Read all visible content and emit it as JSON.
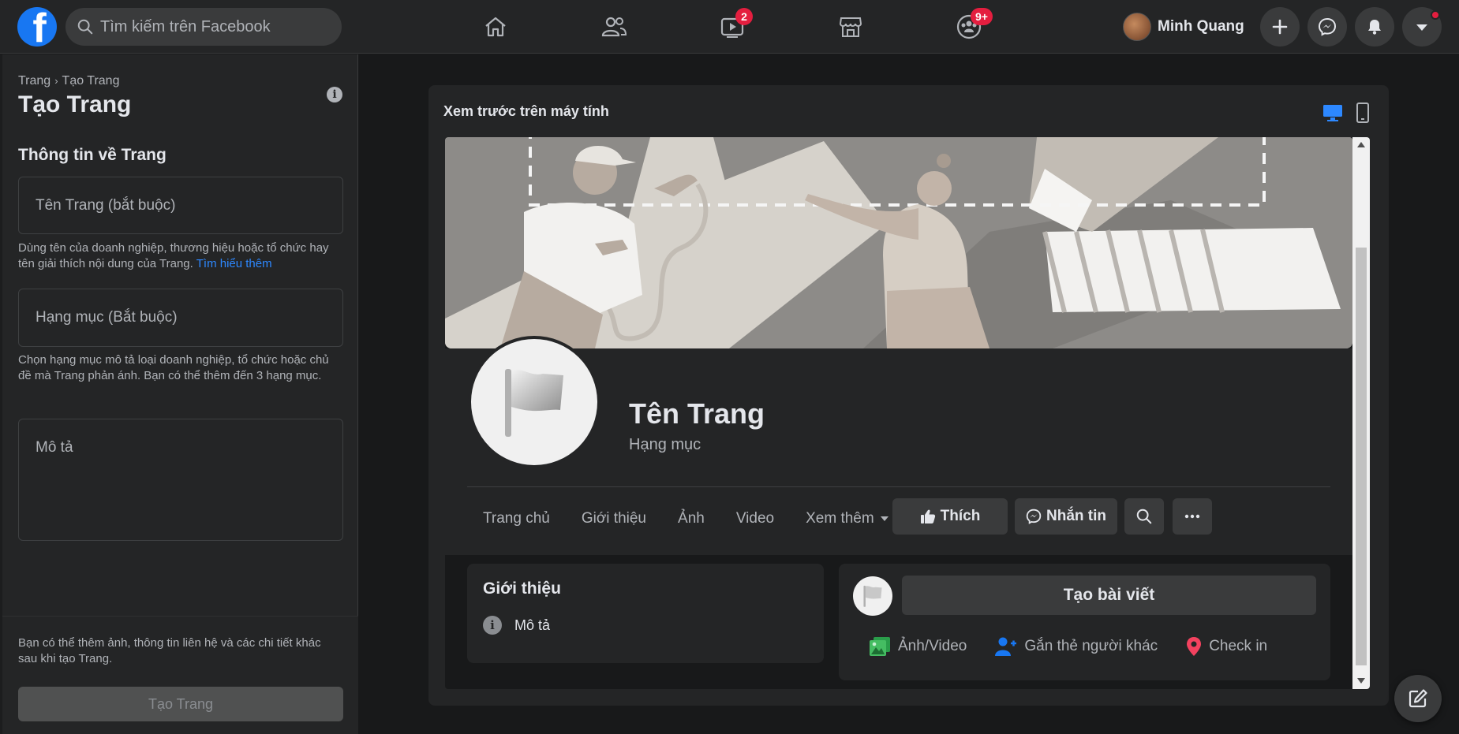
{
  "topbar": {
    "logo_letter": "f",
    "search_placeholder": "Tìm kiếm trên Facebook",
    "nav": [
      {
        "name": "home-icon"
      },
      {
        "name": "friends-icon"
      },
      {
        "name": "watch-icon",
        "badge": "2"
      },
      {
        "name": "marketplace-icon"
      },
      {
        "name": "groups-icon",
        "badge": "9+"
      }
    ],
    "profile_name": "Minh Quang",
    "right_buttons": [
      "plus-icon",
      "messenger-icon",
      "bell-icon",
      "caret-down-icon"
    ]
  },
  "left_panel": {
    "breadcrumb_root": "Trang",
    "breadcrumb_sep": "›",
    "breadcrumb_current": "Tạo Trang",
    "title": "Tạo Trang",
    "section_title": "Thông tin về Trang",
    "name_placeholder": "Tên Trang (bắt buộc)",
    "name_hint": "Dùng tên của doanh nghiệp, thương hiệu hoặc tổ chức hay tên giải thích nội dung của Trang.",
    "learn_more": "Tìm hiểu thêm",
    "category_placeholder": "Hạng mục (Bắt buộc)",
    "category_hint": "Chọn hạng mục mô tả loại doanh nghiệp, tổ chức hoặc chủ đề mà Trang phản ánh. Bạn có thể thêm đến 3 hạng mục.",
    "description_placeholder": "Mô tả",
    "footer_text": "Bạn có thể thêm ảnh, thông tin liên hệ và các chi tiết khác sau khi tạo Trang.",
    "create_button": "Tạo Trang"
  },
  "preview": {
    "title": "Xem trước trên máy tính",
    "page_name": "Tên Trang",
    "category": "Hạng mục",
    "tabs": [
      "Trang chủ",
      "Giới thiệu",
      "Ảnh",
      "Video",
      "Xem thêm"
    ],
    "like_button": "Thích",
    "message_button": "Nhắn tin",
    "intro_title": "Giới thiệu",
    "intro_description": "Mô tả",
    "create_post": "Tạo bài viết",
    "photo_video": "Ảnh/Video",
    "tag_people": "Gắn thẻ người khác",
    "check_in": "Check in"
  },
  "colors": {
    "accent": "#1877f2",
    "link": "#2d88ff",
    "badge": "#e41e3f",
    "background": "#18191a",
    "surface": "#242526"
  }
}
